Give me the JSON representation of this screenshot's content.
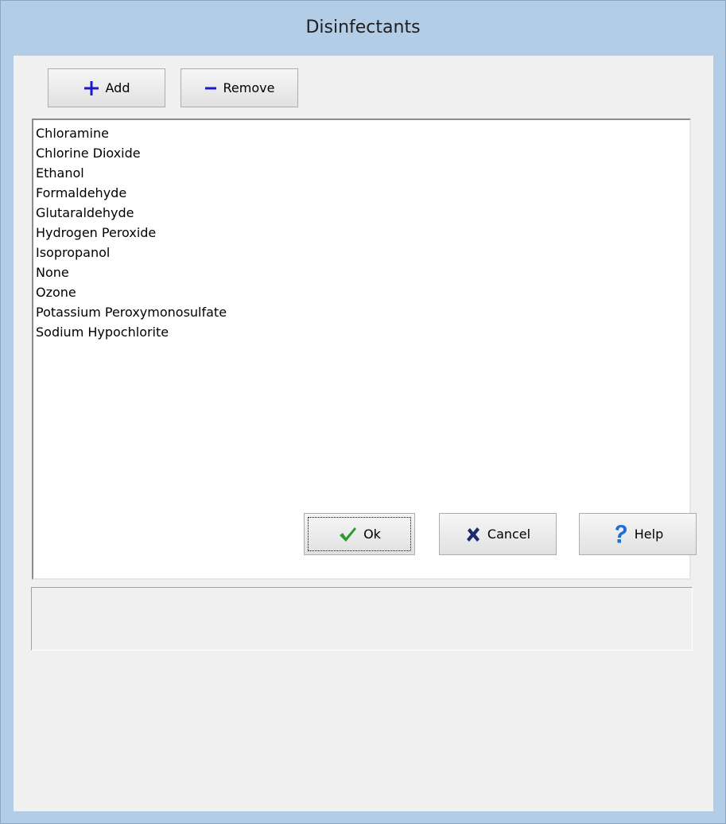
{
  "window": {
    "title": "Disinfectants"
  },
  "toolbar": {
    "add_label": "Add",
    "add_icon": "plus-icon",
    "remove_label": "Remove",
    "remove_icon": "minus-icon"
  },
  "list": {
    "items": [
      "Chloramine",
      "Chlorine Dioxide",
      "Ethanol",
      "Formaldehyde",
      "Glutaraldehyde",
      "Hydrogen Peroxide",
      "Isopropanol",
      "None",
      "Ozone",
      "Potassium Peroxymonosulfate",
      "Sodium Hypochlorite"
    ]
  },
  "footer": {
    "ok_label": "Ok",
    "ok_icon": "checkmark-icon",
    "cancel_label": "Cancel",
    "cancel_icon": "x-icon",
    "help_label": "Help",
    "help_icon": "question-icon"
  },
  "colors": {
    "accent_blue": "#1a1acc",
    "ok_green": "#2e9a2e",
    "cancel_navy": "#1a2a6c",
    "help_blue": "#1f6fd6",
    "titlebar": "#b3cde6"
  }
}
